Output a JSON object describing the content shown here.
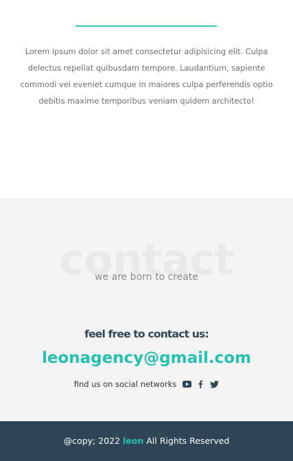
{
  "about": {
    "text": "Lorem ipsum dolor sit amet consectetur adipisicing elit. Culpa delectus repellat quibusdam tempore. Laudantium, sapiente commodi vel eveniet cumque in maiores culpa perferendis optio debitis maxime temporibus veniam quidem architecto!"
  },
  "contact": {
    "watermark": "contact",
    "tagline": "we are born to create",
    "heading": "feel free to contact us:",
    "email": "leonagency@gmail.com",
    "social_label": "find us on social networks",
    "social_icons": [
      "youtube-icon",
      "facebook-icon",
      "twitter-icon"
    ]
  },
  "footer": {
    "prefix": "@copy; 2022",
    "brand": "leon",
    "suffix": "All Rights Reserved"
  },
  "colors": {
    "accent": "#24c0b2",
    "dark": "#2e4656",
    "contact_bg": "#f4f4f4"
  }
}
